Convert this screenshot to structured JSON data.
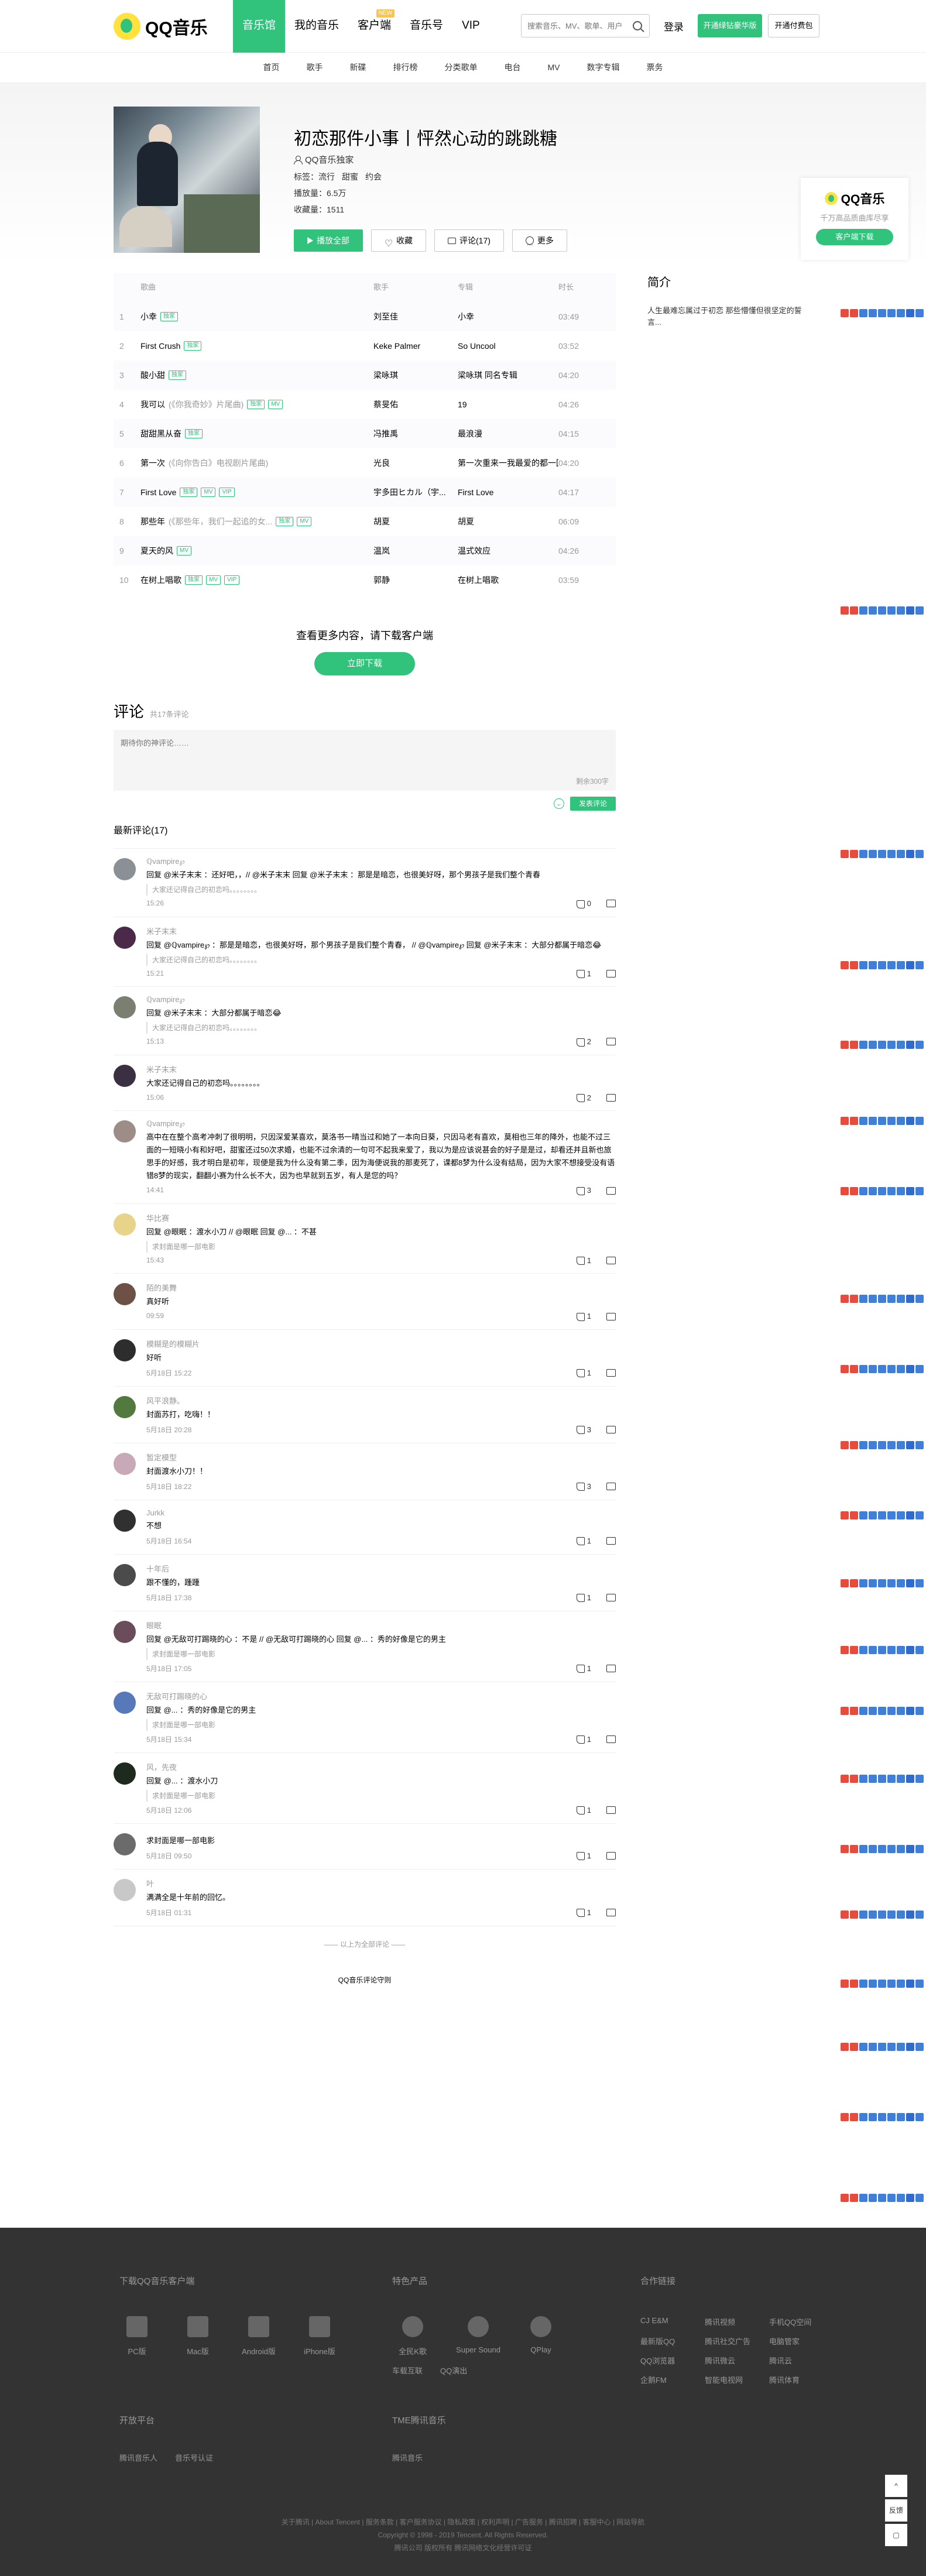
{
  "header": {
    "logo": "QQ音乐",
    "nav": [
      {
        "label": "音乐馆",
        "active": true
      },
      {
        "label": "我的音乐",
        "active": false
      },
      {
        "label": "客户端",
        "active": false,
        "badge": "NEW"
      },
      {
        "label": "音乐号",
        "active": false
      },
      {
        "label": "VIP",
        "active": false
      }
    ],
    "search_placeholder": "搜索音乐、MV、歌单、用户",
    "login": "登录",
    "vip_button": "开通绿钻豪华版",
    "pay_button": "开通付费包"
  },
  "subnav": [
    "首页",
    "歌手",
    "新碟",
    "排行榜",
    "分类歌单",
    "电台",
    "MV",
    "数字专辑",
    "票务"
  ],
  "album": {
    "title": "初恋那件小事丨怦然心动的跳跳糖",
    "artist": "QQ音乐独家",
    "tags_label": "标签：",
    "tags": [
      "流行",
      "甜蜜",
      "约会"
    ],
    "plays": "播放量：6.5万",
    "favorites": "收藏量：1511",
    "buttons": {
      "play": "播放全部",
      "fav": "收藏",
      "comment": "评论(17)",
      "more": "更多"
    }
  },
  "appcard": {
    "name": "QQ音乐",
    "slogan": "千万高品质曲库尽享",
    "button": "客户端下载"
  },
  "songs": {
    "headers": {
      "name": "歌曲",
      "singer": "歌手",
      "album": "专辑",
      "duration": "时长"
    },
    "rows": [
      {
        "idx": "1",
        "name": "小幸",
        "sub": "",
        "badges": [
          "独家"
        ],
        "singer": "刘至佳",
        "album": "小幸",
        "duration": "03:49"
      },
      {
        "idx": "2",
        "name": "First Crush",
        "sub": "",
        "badges": [
          "独家"
        ],
        "singer": "Keke Palmer",
        "album": "So Uncool",
        "duration": "03:52"
      },
      {
        "idx": "3",
        "name": "酸小甜",
        "sub": "",
        "badges": [
          "独家"
        ],
        "singer": "梁咏琪",
        "album": "梁咏琪 同名专辑",
        "duration": "04:20"
      },
      {
        "idx": "4",
        "name": "我可以",
        "sub": "(《你我奇妙》片尾曲)",
        "badges": [
          "独家",
          "MV"
        ],
        "singer": "蔡旻佑",
        "album": "19",
        "duration": "04:26"
      },
      {
        "idx": "5",
        "name": "甜甜黑从奋",
        "sub": "",
        "badges": [
          "独家"
        ],
        "singer": "冯推禹",
        "album": "最浪漫",
        "duration": "04:15"
      },
      {
        "idx": "6",
        "name": "第一次",
        "sub": "(《向你告白》电视剧片尾曲)",
        "badges": [],
        "singer": "光良",
        "album": "第一次重来一我最爱的都一回",
        "duration": "04:20"
      },
      {
        "idx": "7",
        "name": "First Love",
        "sub": "",
        "badges": [
          "独家",
          "MV",
          "VIP"
        ],
        "singer": "宇多田ヒカル（宇...",
        "album": "First Love",
        "duration": "04:17"
      },
      {
        "idx": "8",
        "name": "那些年",
        "sub": "(《那些年，我们一起追的女...",
        "badges": [
          "独家",
          "MV"
        ],
        "singer": "胡夏",
        "album": "胡夏",
        "duration": "06:09"
      },
      {
        "idx": "9",
        "name": "夏天的风",
        "sub": "",
        "badges": [
          "MV"
        ],
        "singer": "温岚",
        "album": "温式效应",
        "duration": "04:26"
      },
      {
        "idx": "10",
        "name": "在树上唱歌",
        "sub": "",
        "badges": [
          "独家",
          "MV",
          "VIP"
        ],
        "singer": "郭静",
        "album": "在树上唱歌",
        "duration": "03:59"
      }
    ]
  },
  "intro": {
    "title": "简介",
    "text": "人生最难忘属过于初恋 那些懵懂但很坚定的誓言..."
  },
  "seemore": {
    "text": "查看更多内容，请下载客户端",
    "button": "立即下载"
  },
  "comments": {
    "title": "评论",
    "count": "共17条评论",
    "placeholder": "期待你的神评论……",
    "remaining": "剩余300字",
    "submit": "发表评论",
    "latest": "最新评论(17)",
    "items": [
      {
        "name": "ℚvampire℘",
        "text": "回复 @米子末末 ：还好吧，，// @米子末末 回复 @米子末末 ：那是是暗恋，也很美好呀，那个男孩子是我们整个青春",
        "quote": "大家还记得自己的初恋吗。。。。。。。。",
        "time": "15:26",
        "likes": "0"
      },
      {
        "name": "米子末末",
        "text": "回复 @ℚvampire℘ ：那是是暗恋，也很美好呀，那个男孩子是我们整个青春， // @ℚvampire℘ 回复 @米子末末 ：大部分都属于暗恋😂",
        "quote": "大家还记得自己的初恋吗。。。。。。。。",
        "time": "15:21",
        "likes": "1"
      },
      {
        "name": "ℚvampire℘",
        "text": "回复 @米子末末 ：大部分都属于暗恋😂",
        "quote": "大家还记得自己的初恋吗。。。。。。。。",
        "time": "15:13",
        "likes": "2"
      },
      {
        "name": "米子末末",
        "text": "大家还记得自己的初恋吗。。。。。。。。",
        "quote": "",
        "time": "15:06",
        "likes": "2"
      },
      {
        "name": "ℚvampire℘",
        "text": "高中在在整个高考冲刺了很明明，只因深爱某喜欢，莫洛书一晴当过和她了一本向日葵，只因马老有喜欢，莫相也三年的降外，也能不过三面的一短晓小有和好吧，甜蜜还过50次求婚，也能不过余清的一句可不起我来爱了，我以为是应该说甚会的好子是是过，却看还并且新也旅思手的好感，我才明白是初年，现便是我为什么没有第二季，因为海便说我的那麦死了，课都8梦为什么没有结局，因为大家不想接受没有语错8梦的现实，翻翻小赛为什么长不大，因为也早就到五岁，有人是您的吗？",
        "quote": "",
        "time": "14:41",
        "likes": "3"
      },
      {
        "name": "华比赛",
        "text": "回复 @眼眠 ：渡水小刀 // @眼眠 回复 @... ：不甚",
        "quote": "求封面是哪一部电影",
        "time": "15:43",
        "likes": "1"
      },
      {
        "name": "陌的美舞",
        "text": "真好听",
        "quote": "",
        "time": "09:59",
        "likes": "1"
      },
      {
        "name": "模糊是的模糊片",
        "text": "好听",
        "quote": "",
        "time": "5月18日 15:22",
        "likes": "1"
      },
      {
        "name": "风平浪静。",
        "text": "封面苏打，吃嗨！！",
        "quote": "",
        "time": "5月18日 20:28",
        "likes": "3"
      },
      {
        "name": "暂定模型",
        "text": "封面渡水小刀！！",
        "quote": "",
        "time": "5月18日 18:22",
        "likes": "3"
      },
      {
        "name": "Jurkk",
        "text": "不想",
        "quote": "",
        "time": "5月18日 16:54",
        "likes": "1"
      },
      {
        "name": "十年后",
        "text": "跟不懂的，踵踵",
        "quote": "",
        "time": "5月18日 17:38",
        "likes": "1"
      },
      {
        "name": "眼眠",
        "text": "回复 @无敌可打踢晓的心 ：不是 // @无敌可打踢晓的心 回复 @... ：秀的好像是它的男主",
        "quote": "求封面是哪一部电影",
        "time": "5月18日 17:05",
        "likes": "1"
      },
      {
        "name": "无敌可打踢晓的心",
        "text": "回复 @... ：秀的好像是它的男主",
        "quote": "求封面是哪一部电影",
        "time": "5月18日 15:34",
        "likes": "1"
      },
      {
        "name": "风，先夜",
        "text": "回复 @... ：渡水小刀",
        "quote": "求封面是哪一部电影",
        "time": "5月18日 12:06",
        "likes": "1"
      },
      {
        "name": "",
        "text": "求封面是哪一部电影",
        "quote": "",
        "time": "5月18日 09:50",
        "likes": "1"
      },
      {
        "name": "叶",
        "text": "满满全是十年前的回忆。",
        "quote": "",
        "time": "5月18日 01:31",
        "likes": "1"
      }
    ],
    "end_text": "—— 以上为全部评论 ——",
    "rules": "QQ音乐评论守则"
  },
  "footer": {
    "download_title": "下载QQ音乐客户端",
    "apps": [
      "PC版",
      "Mac版",
      "Android版",
      "iPhone版"
    ],
    "products_title": "特色产品",
    "products": [
      "全民K歌",
      "Super Sound",
      "QPlay"
    ],
    "products2": [
      "车载互联",
      "QQ演出"
    ],
    "partners_title": "合作链接",
    "partners": [
      "CJ E&M",
      "腾讯视频",
      "手机QQ空间",
      "最新版QQ",
      "腾讯社交广告",
      "电脑管家",
      "QQ浏览器",
      "腾讯微云",
      "腾讯云",
      "企鹅FM",
      "智能电视网",
      "腾讯体育"
    ],
    "open_title": "开放平台",
    "open": [
      "腾讯音乐人",
      "音乐号认证"
    ],
    "tme_title": "TME腾讯音乐",
    "tme": [
      "腾讯音乐"
    ],
    "bottom1": "关于腾讯 | About Tencent | 服务条款 | 客户服务协议 | 隐私政策 | 权利声明 | 广告服务 | 腾讯招聘 | 客服中心 | 网站导航",
    "bottom2": "Copyright © 1998 - 2019 Tencent. All Rights Reserved.",
    "bottom3": "腾讯公司 版权所有 腾讯网络文化经营许可证",
    "side": [
      "反馈"
    ]
  }
}
